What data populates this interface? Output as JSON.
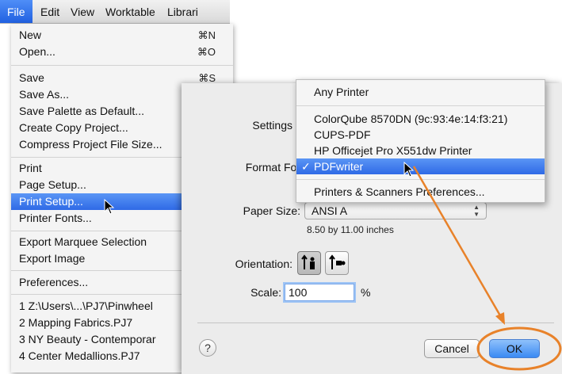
{
  "menubar": {
    "items": [
      "File",
      "Edit",
      "View",
      "Worktable",
      "Librari"
    ]
  },
  "file_menu": {
    "new": {
      "label": "New",
      "shortcut": "⌘N"
    },
    "open": {
      "label": "Open...",
      "shortcut": "⌘O"
    },
    "save": {
      "label": "Save",
      "shortcut": "⌘S"
    },
    "save_as": {
      "label": "Save As..."
    },
    "save_palette": {
      "label": "Save Palette as Default..."
    },
    "create_copy": {
      "label": "Create Copy Project..."
    },
    "compress": {
      "label": "Compress Project File Size..."
    },
    "print": {
      "label": "Print"
    },
    "page_setup": {
      "label": "Page Setup..."
    },
    "print_setup": {
      "label": "Print Setup..."
    },
    "printer_fonts": {
      "label": "Printer Fonts..."
    },
    "export_marquee": {
      "label": "Export Marquee Selection"
    },
    "export_image": {
      "label": "Export Image"
    },
    "preferences": {
      "label": "Preferences..."
    },
    "recent": [
      "1 Z:\\Users\\...\\PJ7\\Pinwheel",
      "2 Mapping Fabrics.PJ7",
      "3 NY Beauty - Contemporar",
      "4 Center Medallions.PJ7"
    ]
  },
  "dialog": {
    "settings_label": "Settings",
    "format_for_label": "Format For",
    "paper_size_label": "Paper Size:",
    "paper_size_value": "ANSI A",
    "paper_dims": "8.50 by 11.00 inches",
    "orientation_label": "Orientation:",
    "scale_label": "Scale:",
    "scale_value": "100",
    "scale_unit": "%",
    "help": "?",
    "cancel": "Cancel",
    "ok": "OK"
  },
  "printer_menu": {
    "items": [
      "Any Printer",
      "ColorQube 8570DN (9c:93:4e:14:f3:21)",
      "CUPS-PDF",
      "HP Officejet Pro X551dw Printer",
      "PDFwriter",
      "Printers & Scanners Preferences..."
    ],
    "check": "✓"
  },
  "colors": {
    "highlight": "#2f6ae6",
    "annotation": "#e8822a"
  }
}
